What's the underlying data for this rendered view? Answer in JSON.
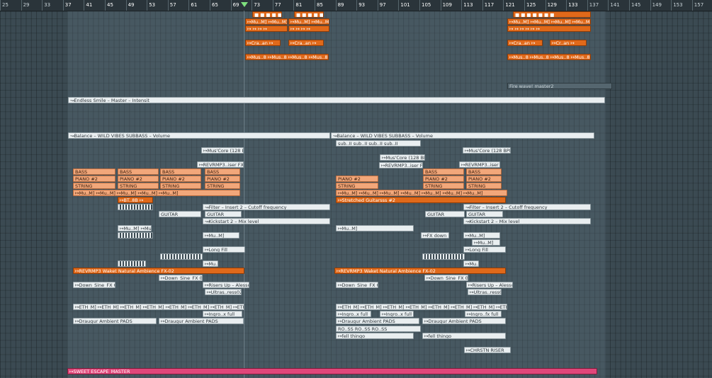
{
  "ruler": {
    "ticks": [
      "25",
      "29",
      "33",
      "37",
      "41",
      "45",
      "49",
      "53",
      "57",
      "61",
      "65",
      "69",
      "73",
      "77",
      "81",
      "85",
      "89",
      "93",
      "97",
      "101",
      "105",
      "109",
      "113",
      "117",
      "121",
      "125",
      "129",
      "133",
      "137",
      "141",
      "145",
      "149",
      "153",
      "157"
    ]
  },
  "clips": [
    {
      "label": "■ ■ ■ ■ ■ ■ ■",
      "color": "orange"
    },
    {
      "label": "■ ■ ■ ■ ■ ■",
      "color": "orange"
    },
    {
      "label": "■ ■ ■ ■ ■ ■ ■",
      "color": "orange"
    },
    {
      "label": "↦Mu..M] ↦Mu..M]",
      "color": "orange"
    },
    {
      "label": "↦Mu..M] ↦Mu..M]",
      "color": "orange"
    },
    {
      "label": "↦Mu..M] ↦Mu..M] ↦Mu..M] ↦Mu..M]",
      "color": "orange"
    },
    {
      "label": "↦ ↦ ↦ ↦",
      "color": "orange"
    },
    {
      "label": "↦ ↦ ↦ ↦",
      "color": "orange"
    },
    {
      "label": "↦ ↦ ↦ ↦ ↦ ↦",
      "color": "orange"
    },
    {
      "label": "↦Cra..an ↦",
      "color": "orange"
    },
    {
      "label": "↦Cra..an ↦",
      "color": "orange"
    },
    {
      "label": "↦Cra..an ↦",
      "color": "orange"
    },
    {
      "label": "↦Cr..an ↦",
      "color": "orange"
    },
    {
      "label": "↦Mus..8 ↦Mus..8 ↦Mus..8 ↦Mus..8",
      "color": "orange"
    },
    {
      "label": "↦Mus..8 ↦Mus..8 ↦Mus..8 ↦Mus..8",
      "color": "orange"
    },
    {
      "label": "Fire wave! master2",
      "color": "dark"
    },
    {
      "label": "↝Endless Smile – Master – Intensit",
      "color": "white"
    },
    {
      "label": "↝Balance – WILD VIBES SUBBASS – Volume",
      "color": "white"
    },
    {
      "label": "↝Balance – WILD VIBES SUBBASS – Volume",
      "color": "white"
    },
    {
      "label": "sub..II sub..II sub..II sub..II",
      "color": "white"
    },
    {
      "label": "↦Mus'Core (128 BPM)",
      "color": "white"
    },
    {
      "label": "↦Mus'Core (128 BPM)",
      "color": "white"
    },
    {
      "label": "↦Mus'Core (128 BPM)",
      "color": "white"
    },
    {
      "label": "↦REVRMP3..iser FX",
      "color": "white"
    },
    {
      "label": "↦REVRMP3..iser FX",
      "color": "white"
    },
    {
      "label": "↦REVRMP3..iser FX",
      "color": "white"
    },
    {
      "label": "BASS",
      "color": "peach"
    },
    {
      "label": "BASS",
      "color": "peach"
    },
    {
      "label": "BASS",
      "color": "peach"
    },
    {
      "label": "BASS",
      "color": "peach"
    },
    {
      "label": "BASS",
      "color": "peach"
    },
    {
      "label": "BASS",
      "color": "peach"
    },
    {
      "label": "PIANO #2",
      "color": "peach"
    },
    {
      "label": "PIANO #2",
      "color": "peach"
    },
    {
      "label": "PIANO #2",
      "color": "peach"
    },
    {
      "label": "PIANO #2",
      "color": "peach"
    },
    {
      "label": "PIANO #2",
      "color": "peach"
    },
    {
      "label": "PIANO #2",
      "color": "peach"
    },
    {
      "label": "PIANO #2",
      "color": "peach"
    },
    {
      "label": "STRING",
      "color": "peach"
    },
    {
      "label": "STRING",
      "color": "peach"
    },
    {
      "label": "STRING",
      "color": "peach"
    },
    {
      "label": "STRING",
      "color": "peach"
    },
    {
      "label": "STRING",
      "color": "peach"
    },
    {
      "label": "STRING",
      "color": "peach"
    },
    {
      "label": "STRING",
      "color": "peach"
    },
    {
      "label": "↦Mu..M] ↦Mu..M] ↦Mu..M] ↦Mu..M] ↦Mu..M]",
      "color": "peach"
    },
    {
      "label": "↦Mu..M] ↦Mu..M] ↦Mu..M] ↦Mu..M] ↦Mu..M] ↦Mu..M] ↦Mu..M]",
      "color": "peach"
    },
    {
      "label": "↦BT..8B ↦",
      "color": "orange"
    },
    {
      "label": "↦Stretched Guitarsss #2",
      "color": "orange"
    },
    {
      "label": "↝Filter – Insert 2 – Cutoff frequency",
      "color": "white"
    },
    {
      "label": "↝Filter – Insert 2 – Cutoff frequency",
      "color": "white"
    },
    {
      "label": "GUITAR",
      "color": "white"
    },
    {
      "label": "GUITAR",
      "color": "white"
    },
    {
      "label": "GUITAR",
      "color": "white"
    },
    {
      "label": "GUITAR",
      "color": "white"
    },
    {
      "label": "↝Kickstart 2 – Mix level",
      "color": "white"
    },
    {
      "label": "↝Kickstart 2 – Mix level",
      "color": "white"
    },
    {
      "label": "↦Mu..M]",
      "color": "white"
    },
    {
      "label": "↦Mu..M]",
      "color": "white"
    },
    {
      "label": "↦Mu..M] ↦Mu..M] ↦Mu..M]",
      "color": "white"
    },
    {
      "label": "↦Mu..M]",
      "color": "white"
    },
    {
      "label": "↦Mu..M]",
      "color": "white"
    },
    {
      "label": "↦FX down",
      "color": "white"
    },
    {
      "label": "↦Long Fill",
      "color": "white"
    },
    {
      "label": "↦Long Fill",
      "color": "white"
    },
    {
      "label": "↦Mu..",
      "color": "white"
    },
    {
      "label": "↦Mu..",
      "color": "white"
    },
    {
      "label": "↦REVRMP3 Waket Natural Ambience FX-02",
      "color": "orange"
    },
    {
      "label": "↦REVRMP3 Waket Natural Ambience FX-02",
      "color": "orange"
    },
    {
      "label": "↦Down_Sine_FX 04",
      "color": "white"
    },
    {
      "label": "↦Down_Sine_FX 04",
      "color": "white"
    },
    {
      "label": "↦Down_Sine_FX 04",
      "color": "white"
    },
    {
      "label": "↦Down_Sine_FX 04",
      "color": "white"
    },
    {
      "label": "↦Risers Up – Alesso",
      "color": "white"
    },
    {
      "label": "↦Risers Up – Alesso",
      "color": "white"
    },
    {
      "label": "↦Ultras..ress029",
      "color": "white"
    },
    {
      "label": "↦Ultras..ress029",
      "color": "white"
    },
    {
      "label": "↦ETH_M] ↦ETH_M] ↦ETH_M] ↦ETH_M] ↦ETH_M] ↦ETH_M] ↦ETH_M] ↦ETH_M] ↦ETH_M] ↦ETH_M]",
      "color": "white"
    },
    {
      "label": "↦ETH_M] ↦ETH_M] ↦ETH_M] ↦ETH_M] ↦ETH_M] ↦ETH_M] ↦ETH_M] ↦ETH_M] ↦ETH_M] ↦ETH_M]",
      "color": "white"
    },
    {
      "label": "↦Ingro..x full",
      "color": "white"
    },
    {
      "label": "↦Ingro..x full",
      "color": "white"
    },
    {
      "label": "↦Ingro..x full",
      "color": "white"
    },
    {
      "label": "↦Ingro..fx full",
      "color": "white"
    },
    {
      "label": "↦Draugur Ambient PADS",
      "color": "white"
    },
    {
      "label": "↦Draugur Ambient PADS",
      "color": "white"
    },
    {
      "label": "↦Draugur Ambient PADS",
      "color": "white"
    },
    {
      "label": "↦Draugur Ambient PADS",
      "color": "white"
    },
    {
      "label": "RO..SS RO..SS RO..SS",
      "color": "white"
    },
    {
      "label": "↦fell thingo",
      "color": "white"
    },
    {
      "label": "↦fell thingo",
      "color": "white"
    },
    {
      "label": "↦CHRSTN RISER",
      "color": "white"
    },
    {
      "label": "↦SWEET ESCAPE_MASTER",
      "color": "pink"
    }
  ]
}
